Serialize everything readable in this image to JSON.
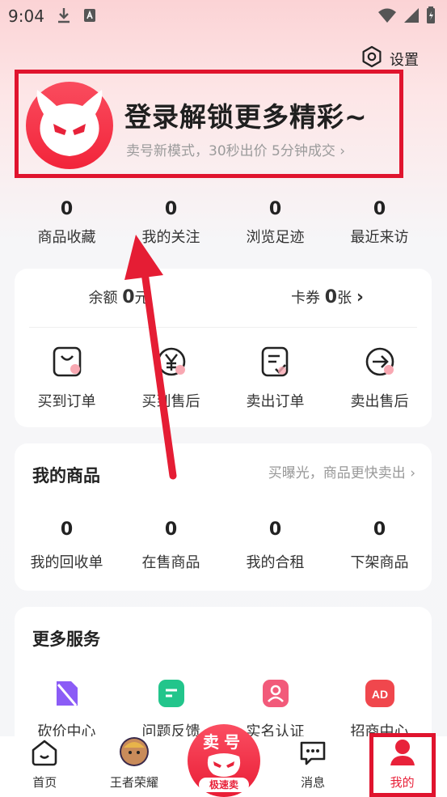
{
  "status_bar": {
    "time": "9:04"
  },
  "header": {
    "settings_label": "设置",
    "title": "登录解锁更多精彩~",
    "subtitle": "卖号新模式，30秒出价 5分钟成交",
    "subtitle_arrow": "›"
  },
  "stats": [
    {
      "value": "0",
      "label": "商品收藏"
    },
    {
      "value": "0",
      "label": "我的关注"
    },
    {
      "value": "0",
      "label": "浏览足迹"
    },
    {
      "value": "0",
      "label": "最近来访"
    }
  ],
  "wallet": {
    "balance_label": "余额",
    "balance_value": "0",
    "balance_unit": "元",
    "coupon_label": "卡券",
    "coupon_value": "0",
    "coupon_unit": "张",
    "arrow": "›"
  },
  "orders": [
    {
      "label": "买到订单",
      "icon": "bag-icon"
    },
    {
      "label": "买到售后",
      "icon": "yen-icon"
    },
    {
      "label": "卖出订单",
      "icon": "sell-order-icon"
    },
    {
      "label": "卖出售后",
      "icon": "return-arrow-icon"
    }
  ],
  "my_goods": {
    "title": "我的商品",
    "hint": "买曝光，商品更快卖出",
    "hint_arrow": "›",
    "items": [
      {
        "value": "0",
        "label": "我的回收单"
      },
      {
        "value": "0",
        "label": "在售商品"
      },
      {
        "value": "0",
        "label": "我的合租"
      },
      {
        "value": "0",
        "label": "下架商品"
      }
    ]
  },
  "more_services": {
    "title": "更多服务",
    "items": [
      {
        "label": "砍价中心",
        "icon": "bargain-icon",
        "color": "#8b5cf6"
      },
      {
        "label": "问题反馈",
        "icon": "feedback-icon",
        "color": "#22c58b"
      },
      {
        "label": "实名认证",
        "icon": "verify-icon",
        "color": "#f25a7a"
      },
      {
        "label": "招商中心",
        "icon": "ad-icon",
        "color": "#f0474d",
        "badge": "AD"
      }
    ]
  },
  "tabbar": {
    "tabs": [
      {
        "label": "首页"
      },
      {
        "label": "王者荣耀"
      },
      {
        "label": ""
      },
      {
        "label": "消息"
      },
      {
        "label": "我的"
      }
    ],
    "sell_title": "卖号",
    "sell_pill": "极速卖"
  },
  "colors": {
    "accent": "#e8223a",
    "highlight_box": "#e0142e"
  }
}
